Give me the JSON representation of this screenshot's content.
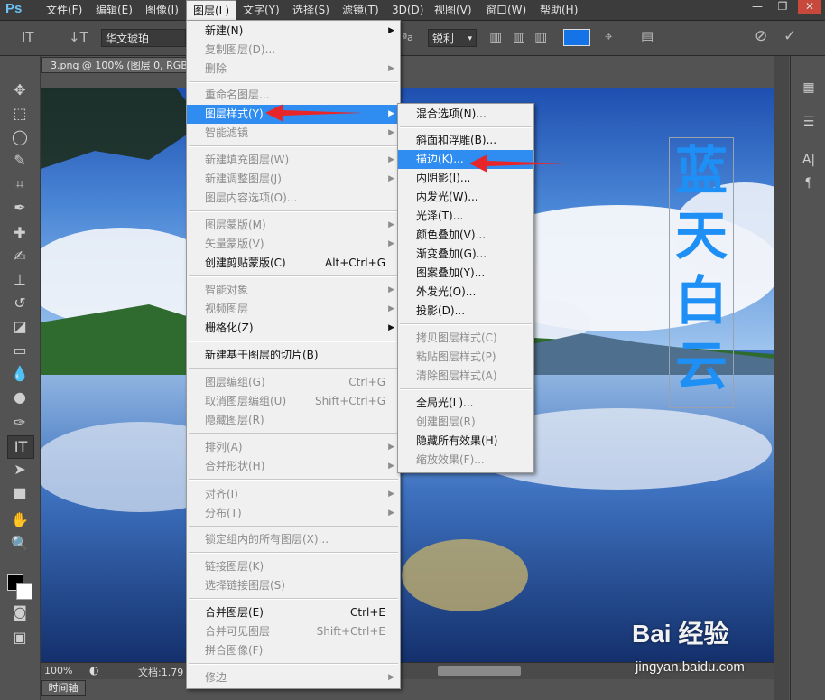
{
  "app": {
    "logo": "Ps"
  },
  "menubar": {
    "items": [
      "文件(F)",
      "编辑(E)",
      "图像(I)",
      "图层(L)",
      "文字(Y)",
      "选择(S)",
      "滤镜(T)",
      "3D(D)",
      "视图(V)",
      "窗口(W)",
      "帮助(H)"
    ],
    "active": "图层(L)"
  },
  "window_controls": {
    "minimize": "—",
    "restore": "❐",
    "close": "✕"
  },
  "options_bar": {
    "font_family": "华文琥珀",
    "antialias_icon_text": "ªa",
    "antialias": "锐利",
    "text_color": "#1473e6"
  },
  "document": {
    "tab_title": "3.png @ 100% (图层 0, RGB",
    "zoom": "100%",
    "doc_info": "文档:1.79",
    "timeline_tab": "时间轴",
    "vertical_text": [
      "蓝",
      "天",
      "白",
      "云"
    ],
    "vertical_text_color": "#1e8ff5"
  },
  "layer_menu": {
    "items": [
      {
        "label": "新建(N)",
        "state": "normal",
        "submenu": true
      },
      {
        "label": "复制图层(D)...",
        "state": "disabled"
      },
      {
        "label": "删除",
        "state": "disabled",
        "submenu": true
      },
      {
        "label": "重命名图层...",
        "state": "disabled"
      },
      {
        "label": "图层样式(Y)",
        "state": "highlighted",
        "submenu": true
      },
      {
        "label": "智能滤镜",
        "state": "disabled",
        "submenu": true
      },
      {
        "label": "新建填充图层(W)",
        "state": "disabled",
        "submenu": true
      },
      {
        "label": "新建调整图层(J)",
        "state": "disabled",
        "submenu": true
      },
      {
        "label": "图层内容选项(O)...",
        "state": "disabled"
      },
      {
        "label": "图层蒙版(M)",
        "state": "disabled",
        "submenu": true
      },
      {
        "label": "矢量蒙版(V)",
        "state": "disabled",
        "submenu": true
      },
      {
        "label": "创建剪贴蒙版(C)",
        "state": "normal",
        "shortcut": "Alt+Ctrl+G"
      },
      {
        "label": "智能对象",
        "state": "disabled",
        "submenu": true
      },
      {
        "label": "视频图层",
        "state": "disabled",
        "submenu": true
      },
      {
        "label": "栅格化(Z)",
        "state": "normal",
        "submenu": true
      },
      {
        "label": "新建基于图层的切片(B)",
        "state": "normal"
      },
      {
        "label": "图层编组(G)",
        "state": "disabled",
        "shortcut": "Ctrl+G"
      },
      {
        "label": "取消图层编组(U)",
        "state": "disabled",
        "shortcut": "Shift+Ctrl+G"
      },
      {
        "label": "隐藏图层(R)",
        "state": "disabled"
      },
      {
        "label": "排列(A)",
        "state": "disabled",
        "submenu": true
      },
      {
        "label": "合并形状(H)",
        "state": "disabled",
        "submenu": true
      },
      {
        "label": "对齐(I)",
        "state": "disabled",
        "submenu": true
      },
      {
        "label": "分布(T)",
        "state": "disabled",
        "submenu": true
      },
      {
        "label": "锁定组内的所有图层(X)...",
        "state": "disabled"
      },
      {
        "label": "链接图层(K)",
        "state": "disabled"
      },
      {
        "label": "选择链接图层(S)",
        "state": "disabled"
      },
      {
        "label": "合并图层(E)",
        "state": "normal",
        "shortcut": "Ctrl+E"
      },
      {
        "label": "合并可见图层",
        "state": "disabled",
        "shortcut": "Shift+Ctrl+E"
      },
      {
        "label": "拼合图像(F)",
        "state": "disabled"
      },
      {
        "label": "修边",
        "state": "disabled",
        "submenu": true
      }
    ]
  },
  "style_submenu": {
    "items": [
      {
        "label": "混合选项(N)...",
        "state": "normal"
      },
      {
        "label": "斜面和浮雕(B)...",
        "state": "normal"
      },
      {
        "label": "描边(K)...",
        "state": "highlighted"
      },
      {
        "label": "内阴影(I)...",
        "state": "normal"
      },
      {
        "label": "内发光(W)...",
        "state": "normal"
      },
      {
        "label": "光泽(T)...",
        "state": "normal"
      },
      {
        "label": "颜色叠加(V)...",
        "state": "normal"
      },
      {
        "label": "渐变叠加(G)...",
        "state": "normal"
      },
      {
        "label": "图案叠加(Y)...",
        "state": "normal"
      },
      {
        "label": "外发光(O)...",
        "state": "normal"
      },
      {
        "label": "投影(D)...",
        "state": "normal"
      },
      {
        "label": "拷贝图层样式(C)",
        "state": "disabled"
      },
      {
        "label": "粘贴图层样式(P)",
        "state": "disabled"
      },
      {
        "label": "清除图层样式(A)",
        "state": "disabled"
      },
      {
        "label": "全局光(L)...",
        "state": "normal"
      },
      {
        "label": "创建图层(R)",
        "state": "disabled"
      },
      {
        "label": "隐藏所有效果(H)",
        "state": "normal"
      },
      {
        "label": "缩放效果(F)...",
        "state": "disabled"
      }
    ]
  },
  "watermark": {
    "brand": "Bai 经验",
    "url": "jingyan.baidu.com"
  },
  "colors": {
    "highlight": "#2f8cf0",
    "annotation_arrow": "#e8262a"
  }
}
